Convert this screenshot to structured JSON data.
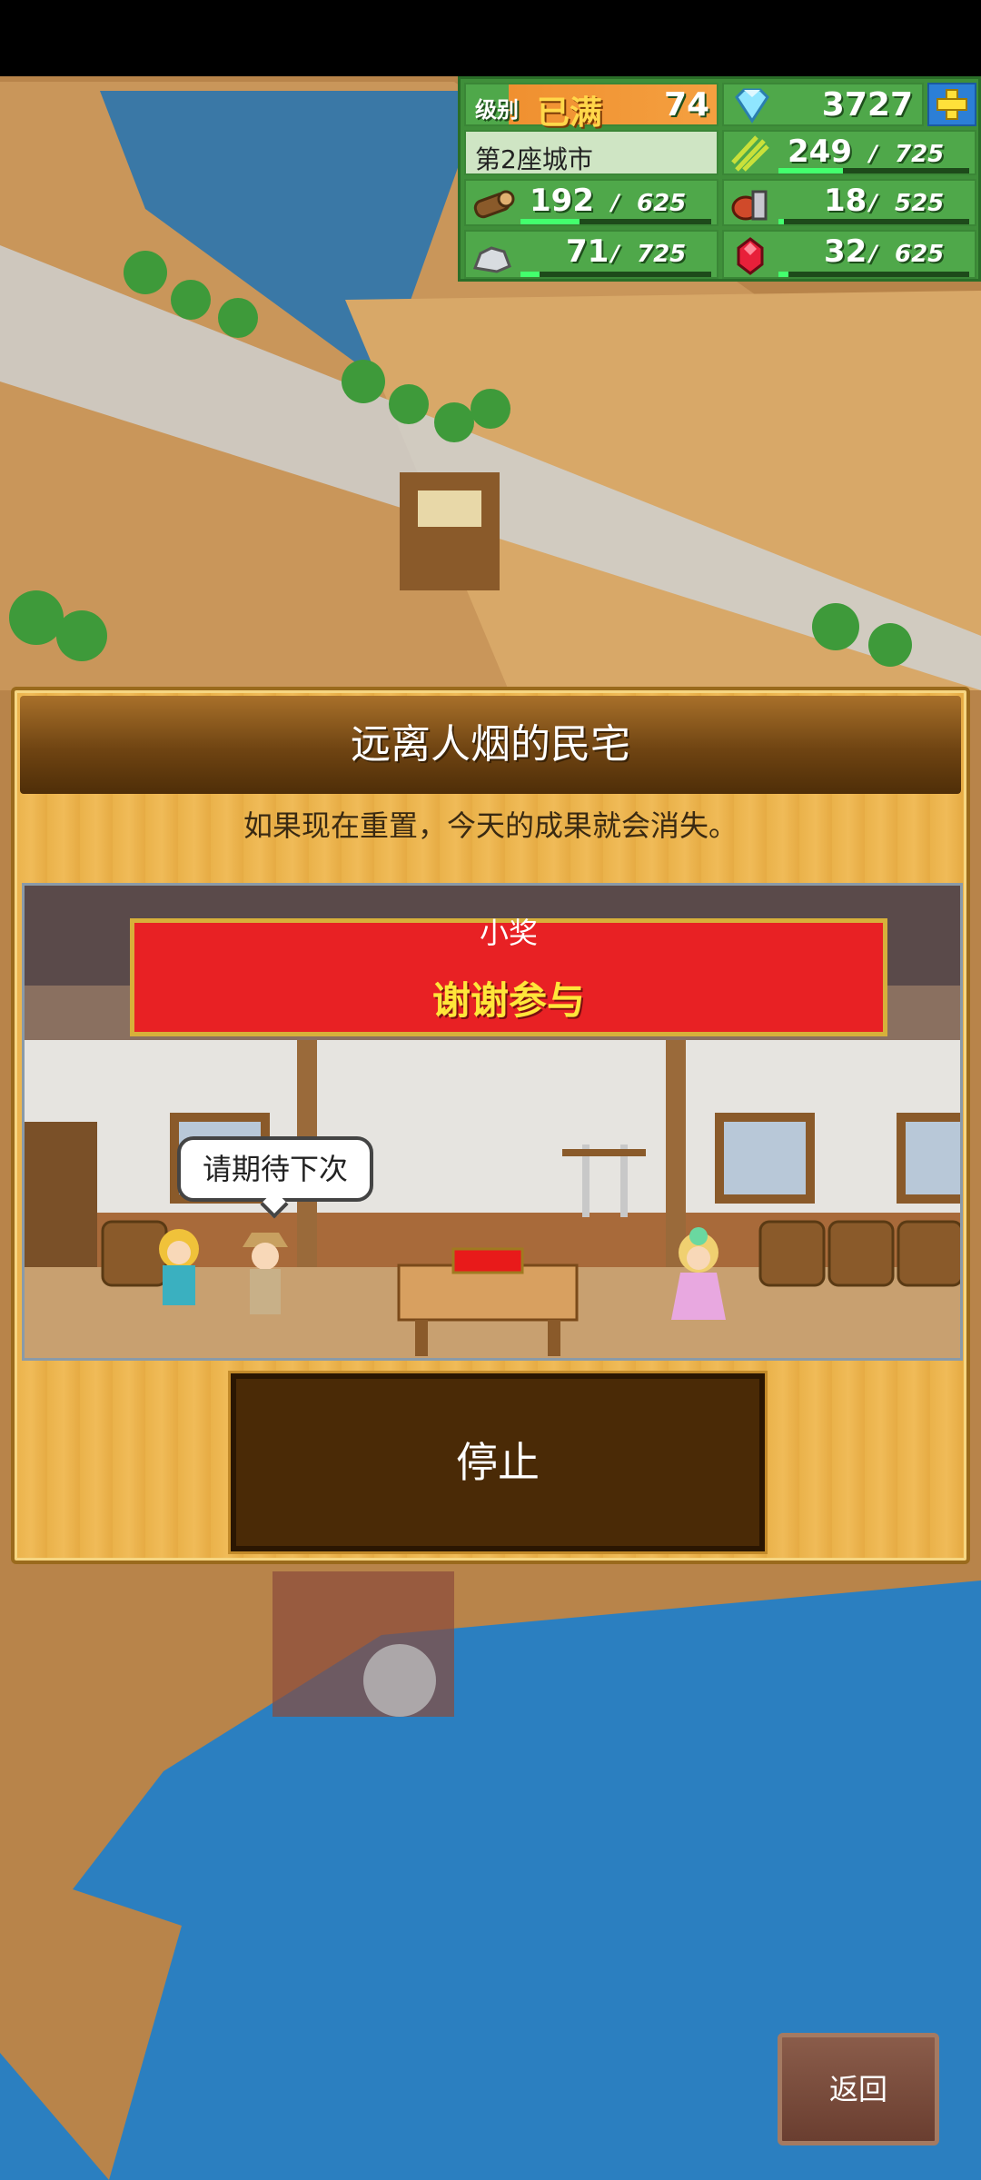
{
  "hud": {
    "level_label": "级别",
    "level_status": "已满",
    "level_value": "74",
    "gems": "3727",
    "city_name": "第2座城市",
    "resources": [
      {
        "icon": "grain-icon",
        "value": "249",
        "max": "725",
        "fill": 0.34
      },
      {
        "icon": "wood-icon",
        "value": "192",
        "max": "625",
        "fill": 0.31
      },
      {
        "icon": "food-icon",
        "value": "18",
        "max": "525",
        "fill": 0.03
      },
      {
        "icon": "ore-icon",
        "value": "71",
        "max": "725",
        "fill": 0.1
      },
      {
        "icon": "ruby-icon",
        "value": "32",
        "max": "625",
        "fill": 0.05
      }
    ],
    "slash": "/"
  },
  "dialog": {
    "title": "远离人烟的民宅",
    "message": "如果现在重置，今天的成果就会消失。",
    "banner_sub": "小奖",
    "banner_main": "谢谢参与",
    "speech": "请期待下次",
    "stop_label": "停止"
  },
  "back_label": "返回",
  "colors": {
    "hud_green": "#4fa84a",
    "banner_red": "#e82124",
    "banner_text": "#ffe63a",
    "button_brown": "#4a2a06"
  }
}
